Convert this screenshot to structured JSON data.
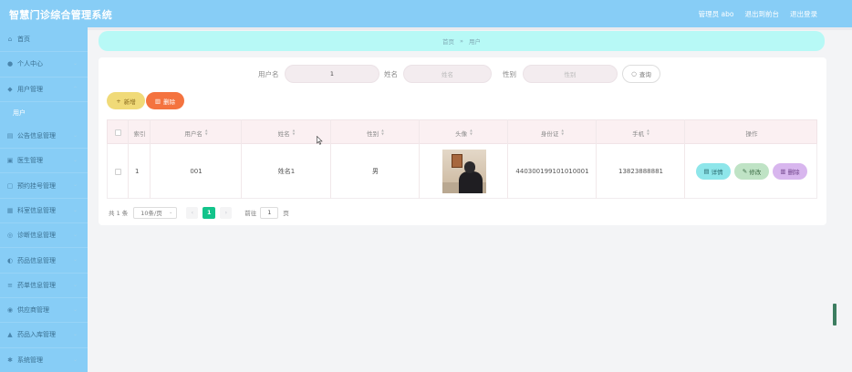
{
  "app": {
    "title": "智慧门诊综合管理系统"
  },
  "header": {
    "links": [
      "管理员 abo",
      "退出到前台",
      "退出登录"
    ]
  },
  "sidebar": {
    "items": [
      {
        "label": "首页",
        "icon": "home-icon"
      },
      {
        "label": "个人中心",
        "icon": "user-icon"
      },
      {
        "label": "用户管理",
        "icon": "shield-icon"
      },
      {
        "label": "公告信息管理",
        "icon": "document-icon"
      },
      {
        "label": "医生管理",
        "icon": "doctor-icon"
      },
      {
        "label": "预约挂号管理",
        "icon": "calendar-icon"
      },
      {
        "label": "科室信息管理",
        "icon": "building-icon"
      },
      {
        "label": "诊断信息管理",
        "icon": "stethoscope-icon"
      },
      {
        "label": "药品信息管理",
        "icon": "pill-icon"
      },
      {
        "label": "药单信息管理",
        "icon": "list-icon"
      },
      {
        "label": "供应商管理",
        "icon": "truck-icon"
      },
      {
        "label": "药品入库管理",
        "icon": "box-icon"
      },
      {
        "label": "系统管理",
        "icon": "gear-icon"
      }
    ],
    "sub_item": "用户"
  },
  "breadcrumb": {
    "home": "首页",
    "sep": "»",
    "current": "用户"
  },
  "search": {
    "username_label": "用户名",
    "username_value": "1",
    "name_label": "姓名",
    "name_placeholder": "姓名",
    "gender_label": "性别",
    "gender_placeholder": "性别",
    "query_label": "查询"
  },
  "toolbar": {
    "add_label": "新增",
    "delete_label": "删除"
  },
  "table": {
    "headers": [
      "索引",
      "用户名",
      "姓名",
      "性别",
      "头像",
      "身份证",
      "手机",
      "操作"
    ],
    "rows": [
      {
        "index": "1",
        "username": "001",
        "name": "姓名1",
        "gender": "男",
        "id_card": "440300199101010001",
        "phone": "13823888881"
      }
    ],
    "actions": {
      "detail": "详情",
      "edit": "修改",
      "remove": "删除"
    }
  },
  "pager": {
    "total": "共 1 条",
    "page_size": "10条/页",
    "current_page": "1",
    "goto_label": "前往",
    "goto_value": "1",
    "page_unit": "页"
  },
  "colors": {
    "accent": "#87cdf6",
    "breadcrumb_bg": "#b7f9f6",
    "page_active": "#13c48b"
  }
}
